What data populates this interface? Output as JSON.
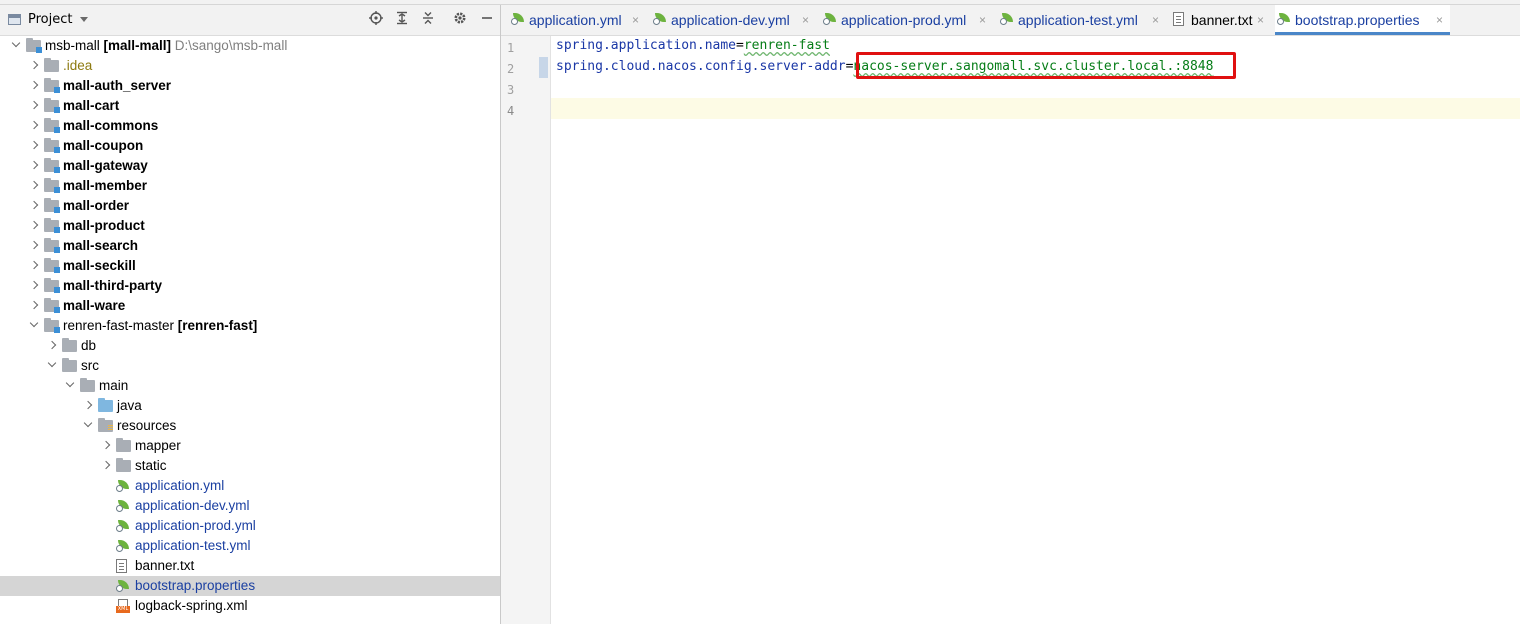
{
  "project_panel": {
    "title": "Project",
    "tree": [
      {
        "label": "msb-mall",
        "extra": "[mall-mall]",
        "path": "D:\\sango\\msb-mall",
        "level": 0,
        "expanded": true,
        "icon": "module-folder-icon"
      },
      {
        "label": ".idea",
        "level": 1,
        "expanded": false,
        "icon": "folder-icon"
      },
      {
        "label": "mall-auth_server",
        "level": 1,
        "expanded": false,
        "icon": "module-folder-icon"
      },
      {
        "label": "mall-cart",
        "level": 1,
        "expanded": false,
        "icon": "module-folder-icon"
      },
      {
        "label": "mall-commons",
        "level": 1,
        "expanded": false,
        "icon": "module-folder-icon"
      },
      {
        "label": "mall-coupon",
        "level": 1,
        "expanded": false,
        "icon": "module-folder-icon"
      },
      {
        "label": "mall-gateway",
        "level": 1,
        "expanded": false,
        "icon": "module-folder-icon"
      },
      {
        "label": "mall-member",
        "level": 1,
        "expanded": false,
        "icon": "module-folder-icon"
      },
      {
        "label": "mall-order",
        "level": 1,
        "expanded": false,
        "icon": "module-folder-icon"
      },
      {
        "label": "mall-product",
        "level": 1,
        "expanded": false,
        "icon": "module-folder-icon"
      },
      {
        "label": "mall-search",
        "level": 1,
        "expanded": false,
        "icon": "module-folder-icon"
      },
      {
        "label": "mall-seckill",
        "level": 1,
        "expanded": false,
        "icon": "module-folder-icon"
      },
      {
        "label": "mall-third-party",
        "level": 1,
        "expanded": false,
        "icon": "module-folder-icon"
      },
      {
        "label": "mall-ware",
        "level": 1,
        "expanded": false,
        "icon": "module-folder-icon"
      },
      {
        "label": "renren-fast-master",
        "extra": "[renren-fast]",
        "level": 1,
        "expanded": true,
        "icon": "module-folder-icon"
      },
      {
        "label": "db",
        "level": 2,
        "expanded": false,
        "icon": "folder-icon"
      },
      {
        "label": "src",
        "level": 2,
        "expanded": true,
        "icon": "folder-icon"
      },
      {
        "label": "main",
        "level": 3,
        "expanded": true,
        "icon": "folder-icon"
      },
      {
        "label": "java",
        "level": 4,
        "expanded": false,
        "icon": "source-folder-icon"
      },
      {
        "label": "resources",
        "level": 4,
        "expanded": true,
        "icon": "resources-folder-icon"
      },
      {
        "label": "mapper",
        "level": 5,
        "expanded": false,
        "icon": "folder-icon"
      },
      {
        "label": "static",
        "level": 5,
        "expanded": false,
        "icon": "folder-icon"
      },
      {
        "label": "application.yml",
        "level": 5,
        "icon": "spring-config-icon"
      },
      {
        "label": "application-dev.yml",
        "level": 5,
        "icon": "spring-config-icon"
      },
      {
        "label": "application-prod.yml",
        "level": 5,
        "icon": "spring-config-icon"
      },
      {
        "label": "application-test.yml",
        "level": 5,
        "icon": "spring-config-icon"
      },
      {
        "label": "banner.txt",
        "level": 5,
        "icon": "text-file-icon"
      },
      {
        "label": "bootstrap.properties",
        "level": 5,
        "icon": "spring-config-icon",
        "selected": true
      },
      {
        "label": "logback-spring.xml",
        "level": 5,
        "icon": "xml-file-icon"
      }
    ]
  },
  "editor": {
    "tabs": [
      {
        "label": "application.yml",
        "icon": "spring-config-icon"
      },
      {
        "label": "application-dev.yml",
        "icon": "spring-config-icon"
      },
      {
        "label": "application-prod.yml",
        "icon": "spring-config-icon"
      },
      {
        "label": "application-test.yml",
        "icon": "spring-config-icon"
      },
      {
        "label": "banner.txt",
        "icon": "text-file-icon"
      },
      {
        "label": "bootstrap.properties",
        "icon": "spring-config-icon",
        "active": true
      }
    ],
    "close_glyph": "×",
    "lines": [
      {
        "num": "1",
        "key": "spring.application.name",
        "eq": "=",
        "value": "renren-fast"
      },
      {
        "num": "2",
        "key": "spring.cloud.nacos.config.server-addr",
        "eq": "=",
        "value": "nacos-server.sangomall.svc.cluster.local.:8848"
      },
      {
        "num": "3",
        "key": "",
        "eq": "",
        "value": ""
      },
      {
        "num": "4",
        "key": "",
        "eq": "",
        "value": ""
      }
    ],
    "current_line": "4"
  },
  "colors": {
    "highlight_box": "#e01010",
    "key": "#1a37a6",
    "value": "#067d17",
    "active_tab_underline": "#4a86c8"
  }
}
